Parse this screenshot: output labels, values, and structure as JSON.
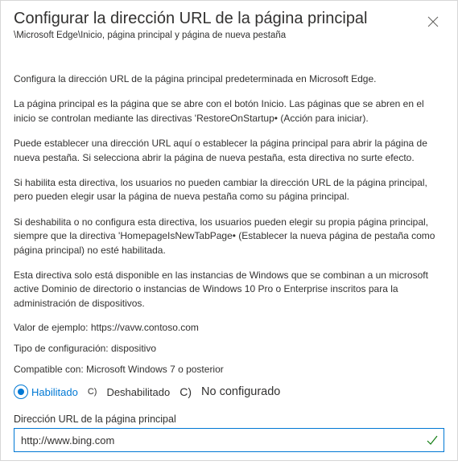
{
  "header": {
    "title": "Configurar la dirección URL de la página principal",
    "breadcrumb": "\\Microsoft Edge\\Inicio, página principal y página de nueva pestaña"
  },
  "description": {
    "p1": "Configura la dirección URL de la página principal predeterminada en Microsoft Edge.",
    "p2": "La página principal es la página que se abre con el botón Inicio. Las páginas que se abren en el inicio se controlan mediante las directivas 'RestoreOnStartup• (Acción para iniciar).",
    "p3": "Puede establecer una dirección URL aquí o establecer la página principal para abrir la página de nueva pestaña. Si selecciona abrir la página de nueva pestaña, esta directiva no surte efecto.",
    "p4": "Si habilita esta directiva, los usuarios no pueden cambiar la dirección URL de la página principal, pero pueden elegir usar la página de nueva pestaña como su página principal.",
    "p5": "Si deshabilita o no configura esta directiva, los usuarios pueden elegir su propia página principal, siempre que la directiva 'HomepageIsNewTabPage• (Establecer la nueva página de pestaña como página principal) no esté habilitada.",
    "p6": "Esta directiva solo está disponible en las instancias de Windows que se combinan a un microsoft active Dominio de directorio o instancias de Windows 10 Pro o Enterprise inscritos para la administración de dispositivos."
  },
  "meta": {
    "example": "Valor de ejemplo: https://vavw.contoso.com",
    "setting_type": "Tipo de configuración: dispositivo",
    "compatible": "Compatible con: Microsoft Windows 7 o posterior"
  },
  "radio": {
    "enabled": "Habilitado",
    "disabled": "Deshabilitado",
    "not_configured": "No configurado",
    "marker_c": "C)"
  },
  "field": {
    "label": "Dirección URL de la página principal",
    "value": "http://www.bing.com"
  }
}
